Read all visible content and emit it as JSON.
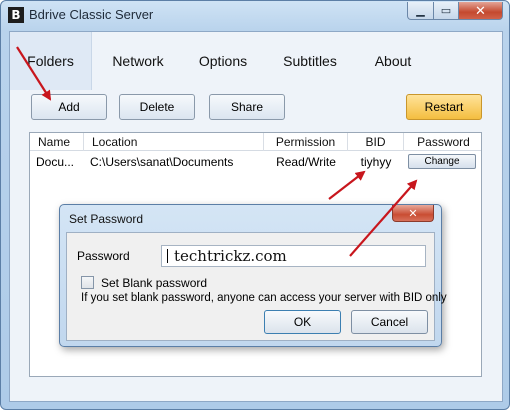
{
  "window": {
    "title": "Bdrive Classic Server",
    "icon_letter": "B",
    "controls": {
      "minimize": "▁",
      "maximize": "▭",
      "close": "✕"
    }
  },
  "tabs": [
    {
      "label": "Folders",
      "active": true
    },
    {
      "label": "Network",
      "active": false
    },
    {
      "label": "Options",
      "active": false
    },
    {
      "label": "Subtitles",
      "active": false
    },
    {
      "label": "About",
      "active": false
    }
  ],
  "toolbar": {
    "add_label": "Add",
    "delete_label": "Delete",
    "share_label": "Share",
    "restart_label": "Restart"
  },
  "table": {
    "columns": [
      "Name",
      "Location",
      "Permission",
      "BID",
      "Password"
    ],
    "rows": [
      {
        "name": "Docu...",
        "location": "C:\\Users\\sanat\\Documents",
        "permission": "Read/Write",
        "bid": "tiyhyy",
        "password_button": "Change"
      }
    ]
  },
  "dialog": {
    "title": "Set Password",
    "close": "✕",
    "password_label": "Password",
    "password_value": "techtrickz.com",
    "blank_checkbox_label": "Set Blank password",
    "blank_checked": false,
    "info_text": "If you set blank password, anyone can access your server with BID only",
    "ok_label": "OK",
    "cancel_label": "Cancel"
  },
  "colors": {
    "accent_restart": "#f4be40",
    "arrow": "#c8161d",
    "dialog_close": "#c94d33"
  },
  "icons": {
    "app": "bdrive-app-icon",
    "annotation": "red-arrow-icon"
  }
}
